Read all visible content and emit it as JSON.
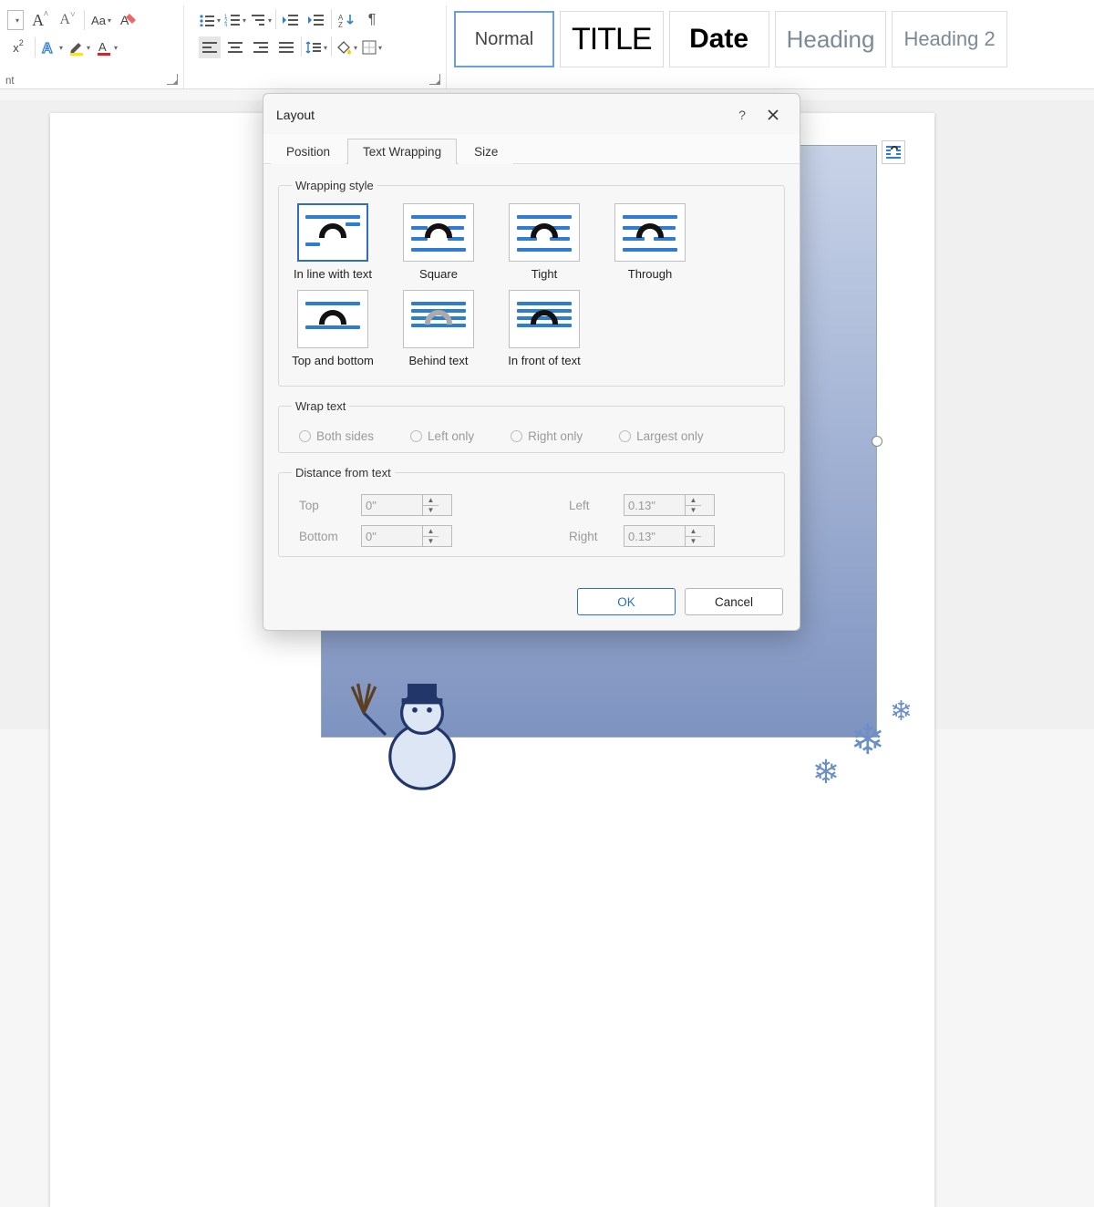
{
  "ribbon": {
    "font_group_label": "nt",
    "grow_font": "A^",
    "shrink_font": "A˅",
    "change_case": "Aa",
    "clear_format": "A◊",
    "superscript": "x²",
    "text_effects": "A",
    "highlight": "✎",
    "font_color": "A",
    "bullets": "•",
    "numbering": "≡",
    "multilevel": "≔",
    "dec_indent": "⇤",
    "inc_indent": "⇥",
    "sort": "A↓Z",
    "show_marks": "¶",
    "align_left": "≡",
    "align_center": "≡",
    "align_right": "≡",
    "justify": "≡",
    "line_spacing": "↕≡",
    "shading": "◪",
    "borders": "⊞"
  },
  "styles": {
    "normal": "Normal",
    "title": "TITLE",
    "date": "Date",
    "heading1": "Heading",
    "heading2": "Heading 2"
  },
  "dialog": {
    "title": "Layout",
    "help": "?",
    "close": "✕",
    "tabs": {
      "position": "Position",
      "wrapping": "Text Wrapping",
      "size": "Size"
    },
    "wrap_style_legend": "Wrapping style",
    "options": {
      "inline": "In line with text",
      "square": "Square",
      "tight": "Tight",
      "through": "Through",
      "topbottom": "Top and bottom",
      "behind": "Behind text",
      "infront": "In front of text"
    },
    "wrap_text_legend": "Wrap text",
    "wrap_text": {
      "both": "Both sides",
      "left": "Left only",
      "right": "Right only",
      "largest": "Largest only"
    },
    "distance_legend": "Distance from text",
    "distance": {
      "top_label": "Top",
      "top_value": "0\"",
      "bottom_label": "Bottom",
      "bottom_value": "0\"",
      "left_label": "Left",
      "left_value": "0.13\"",
      "right_label": "Right",
      "right_value": "0.13\""
    },
    "ok": "OK",
    "cancel": "Cancel"
  }
}
